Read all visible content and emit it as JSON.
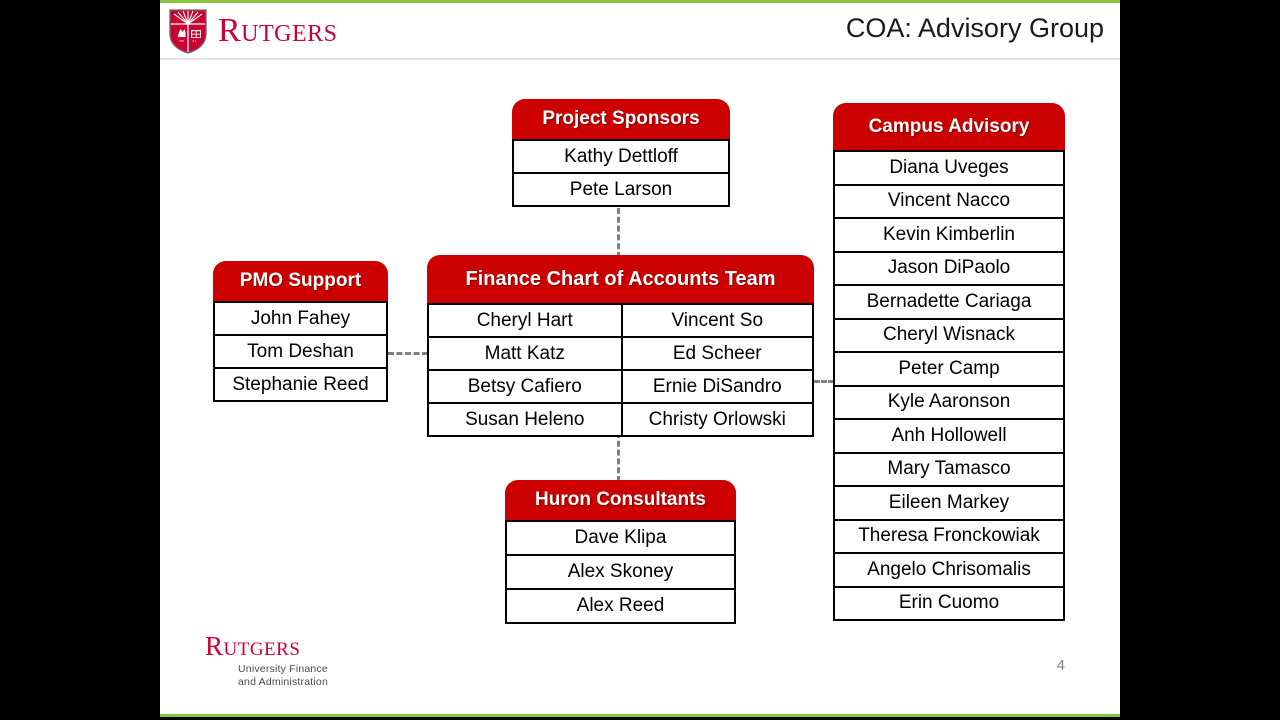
{
  "window": {
    "letterbox_color": "#000000",
    "frame_accent_color": "#8CC63E"
  },
  "header": {
    "brand_wordmark": "Rutgers",
    "shield_icon": "rutgers-shield-icon",
    "title": "COA: Advisory Group"
  },
  "colors": {
    "header_red": "#CC0000",
    "brand_red": "#CC0033",
    "box_border": "#000000",
    "connector": "#808080"
  },
  "chart": {
    "boxes": [
      {
        "id": "sponsors",
        "title": "Project Sponsors",
        "members": [
          "Kathy Dettloff",
          "Pete Larson"
        ]
      },
      {
        "id": "pmo",
        "title": "PMO Support",
        "members": [
          "John Fahey",
          "Tom Deshan",
          "Stephanie Reed"
        ]
      },
      {
        "id": "finance",
        "title": "Finance Chart of Accounts Team",
        "rows": [
          [
            "Cheryl Hart",
            "Vincent So"
          ],
          [
            "Matt Katz",
            "Ed Scheer"
          ],
          [
            "Betsy Cafiero",
            "Ernie DiSandro"
          ],
          [
            "Susan Heleno",
            "Christy Orlowski"
          ]
        ]
      },
      {
        "id": "huron",
        "title": "Huron Consultants",
        "members": [
          "Dave Klipa",
          "Alex Skoney",
          "Alex Reed"
        ]
      },
      {
        "id": "advisory",
        "title": "Campus Advisory",
        "members": [
          "Diana Uveges",
          "Vincent Nacco",
          "Kevin Kimberlin",
          "Jason DiPaolo",
          "Bernadette Cariaga",
          "Cheryl Wisnack",
          "Peter Camp",
          "Kyle Aaronson",
          "Anh Hollowell",
          "Mary Tamasco",
          "Eileen Markey",
          "Theresa Fronckowiak",
          "Angelo Chrisomalis",
          "Erin Cuomo"
        ]
      }
    ],
    "connectors": [
      {
        "from": "sponsors",
        "to": "finance",
        "style": "dashed",
        "orientation": "vertical"
      },
      {
        "from": "finance",
        "to": "huron",
        "style": "dashed",
        "orientation": "vertical"
      },
      {
        "from": "pmo",
        "to": "finance",
        "style": "dashed",
        "orientation": "horizontal"
      },
      {
        "from": "finance",
        "to": "advisory",
        "style": "dashed",
        "orientation": "horizontal"
      }
    ]
  },
  "footer": {
    "wordmark": "Rutgers",
    "unit_line1": "University Finance",
    "unit_line2": "and Administration",
    "page_number": "4"
  }
}
